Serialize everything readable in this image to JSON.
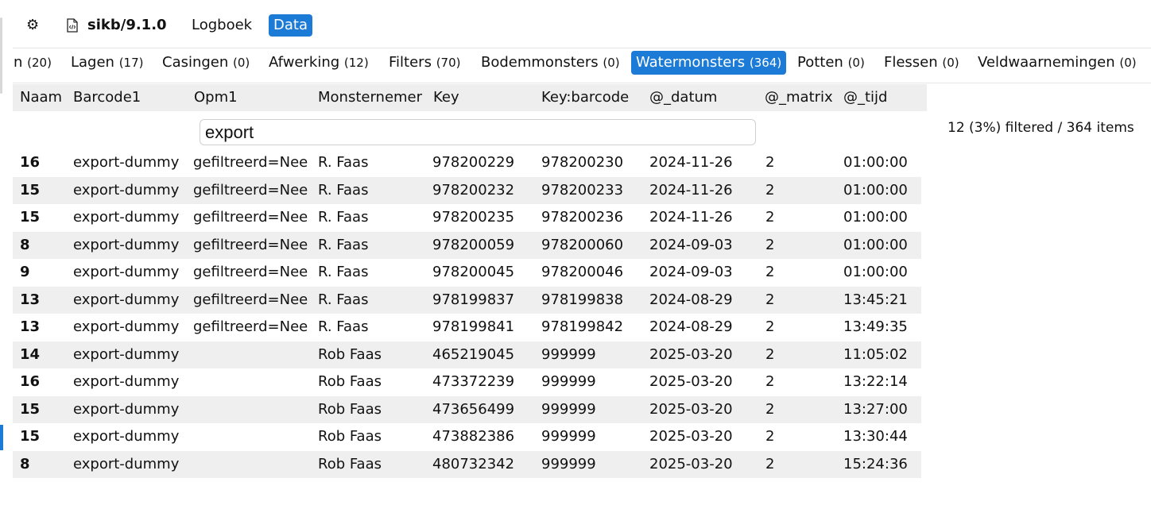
{
  "topbar": {
    "settings_icon": "gear-icon",
    "file_icon": "file-code-icon",
    "project_label": "sikb/9.1.0",
    "logboek_label": "Logboek",
    "data_label": "Data"
  },
  "tabs": [
    {
      "label": "n",
      "count": "(20)",
      "active": false
    },
    {
      "label": "Lagen",
      "count": "(17)",
      "active": false
    },
    {
      "label": "Casingen",
      "count": "(0)",
      "active": false
    },
    {
      "label": "Afwerking",
      "count": "(12)",
      "active": false
    },
    {
      "label": "Filters",
      "count": "(70)",
      "active": false
    },
    {
      "label": "Bodemmonsters",
      "count": "(0)",
      "active": false
    },
    {
      "label": "Watermonsters",
      "count": "(364)",
      "active": true
    },
    {
      "label": "Potten",
      "count": "(0)",
      "active": false
    },
    {
      "label": "Flessen",
      "count": "(0)",
      "active": false
    },
    {
      "label": "Veldwaarnemingen",
      "count": "(0)",
      "active": false
    }
  ],
  "table": {
    "columns": [
      "Naam",
      "Barcode1",
      "Opm1",
      "Monsternemer",
      "Key",
      "Key:barcode",
      "@_datum",
      "@_matrix",
      "@_tijd"
    ],
    "filter_value": "export",
    "filter_status": "12 (3%) filtered / 364 items",
    "rows": [
      [
        "16",
        "export-dummy",
        "gefiltreerd=Nee",
        "R. Faas",
        "978200229",
        "978200230",
        "2024-11-26",
        "2",
        "01:00:00"
      ],
      [
        "15",
        "export-dummy",
        "gefiltreerd=Nee",
        "R. Faas",
        "978200232",
        "978200233",
        "2024-11-26",
        "2",
        "01:00:00"
      ],
      [
        "15",
        "export-dummy",
        "gefiltreerd=Nee",
        "R. Faas",
        "978200235",
        "978200236",
        "2024-11-26",
        "2",
        "01:00:00"
      ],
      [
        "8",
        "export-dummy",
        "gefiltreerd=Nee",
        "R. Faas",
        "978200059",
        "978200060",
        "2024-09-03",
        "2",
        "01:00:00"
      ],
      [
        "9",
        "export-dummy",
        "gefiltreerd=Nee",
        "R. Faas",
        "978200045",
        "978200046",
        "2024-09-03",
        "2",
        "01:00:00"
      ],
      [
        "13",
        "export-dummy",
        "gefiltreerd=Nee",
        "R. Faas",
        "978199837",
        "978199838",
        "2024-08-29",
        "2",
        "13:45:21"
      ],
      [
        "13",
        "export-dummy",
        "gefiltreerd=Nee",
        "R. Faas",
        "978199841",
        "978199842",
        "2024-08-29",
        "2",
        "13:49:35"
      ],
      [
        "14",
        "export-dummy",
        "",
        "Rob Faas",
        "465219045",
        "999999",
        "2025-03-20",
        "2",
        "11:05:02"
      ],
      [
        "16",
        "export-dummy",
        "",
        "Rob Faas",
        "473372239",
        "999999",
        "2025-03-20",
        "2",
        "13:22:14"
      ],
      [
        "15",
        "export-dummy",
        "",
        "Rob Faas",
        "473656499",
        "999999",
        "2025-03-20",
        "2",
        "13:27:00"
      ],
      [
        "15",
        "export-dummy",
        "",
        "Rob Faas",
        "473882386",
        "999999",
        "2025-03-20",
        "2",
        "13:30:44"
      ],
      [
        "8",
        "export-dummy",
        "",
        "Rob Faas",
        "480732342",
        "999999",
        "2025-03-20",
        "2",
        "15:24:36"
      ]
    ]
  },
  "colors": {
    "accent": "#1c7bd6",
    "row_alt": "#efefef",
    "header_bg": "#eeeeee"
  }
}
